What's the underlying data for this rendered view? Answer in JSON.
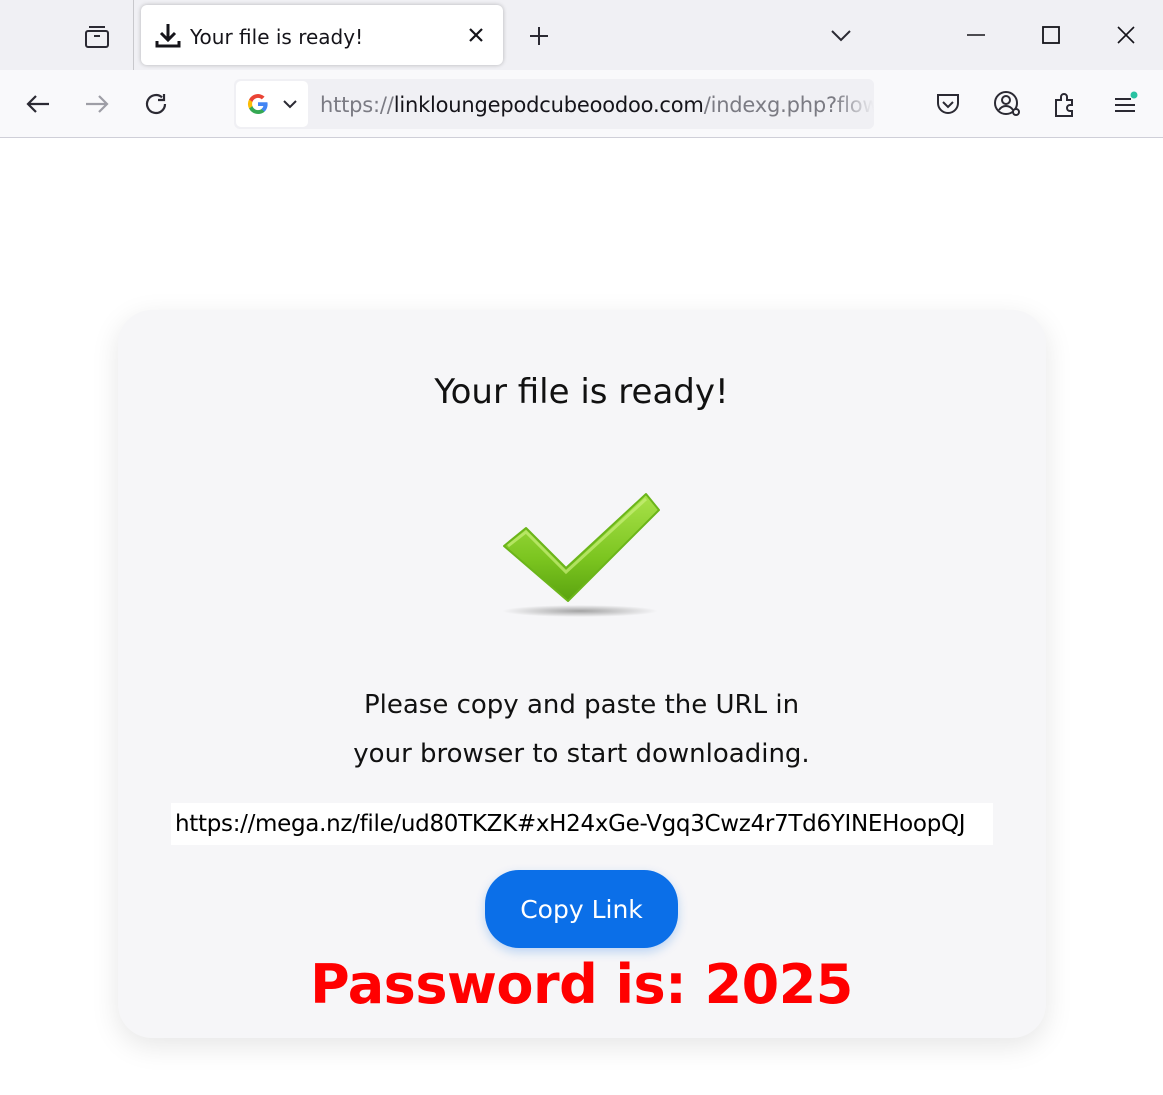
{
  "browser": {
    "tab": {
      "title": "Your file is ready!",
      "icon": "download-icon"
    },
    "url": {
      "scheme": "https://",
      "host": "linkloungepodcubeoodoo.com",
      "rest": "/indexg.php?flow"
    },
    "search_engine_icon": "google-icon"
  },
  "page": {
    "title": "Your file is ready!",
    "instruction_line1": "Please copy and paste the URL in",
    "instruction_line2": "your browser to start downloading.",
    "link_value": "https://mega.nz/file/ud80TKZK#xH24xGe-Vgq3Cwz4r7Td6YINEHoopQJ",
    "copy_button": "Copy Link",
    "password_text": "Password is: 2025"
  },
  "colors": {
    "accent": "#0b6fe8",
    "password": "#ff0000",
    "check": "#7cc520"
  }
}
